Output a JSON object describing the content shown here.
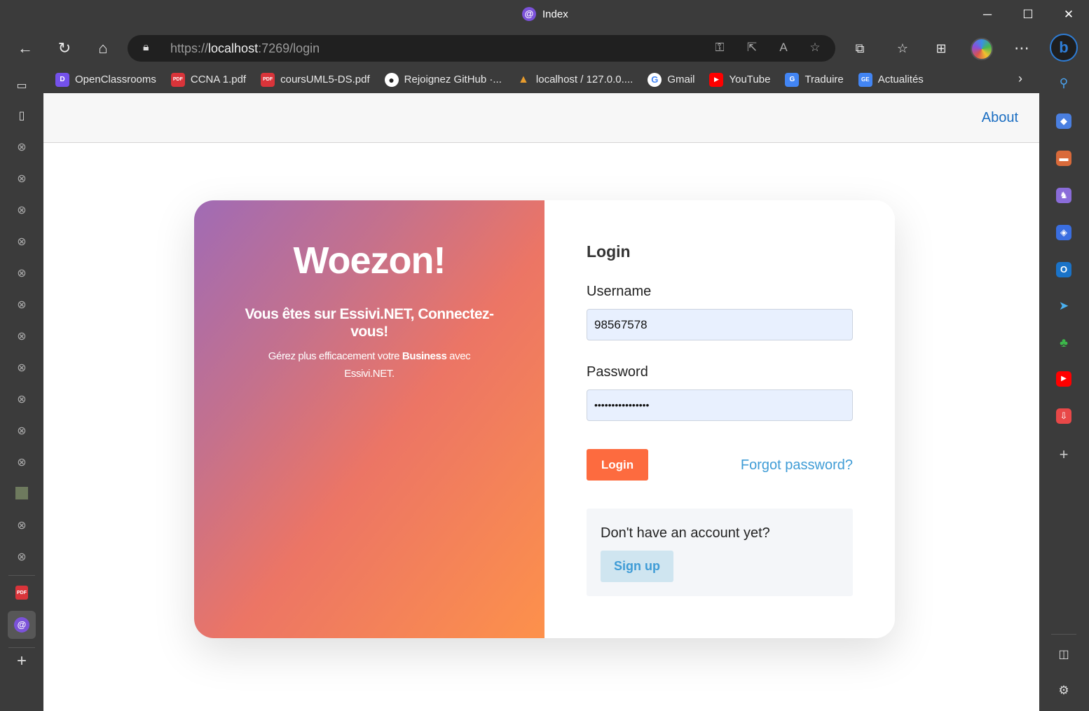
{
  "window": {
    "title": "Index",
    "controls": {
      "minimize": "─",
      "maximize": "☐",
      "close": "✕"
    }
  },
  "nav": {
    "url_scheme": "https://",
    "url_host": "localhost",
    "url_rest": ":7269/login"
  },
  "bookmarks": [
    {
      "label": "OpenClassrooms",
      "icon": "openclassrooms-icon",
      "color": "#7451eb",
      "glyph": "D"
    },
    {
      "label": "CCNA 1.pdf",
      "icon": "pdf-icon",
      "color": "#d9343a",
      "glyph": "PDF"
    },
    {
      "label": "coursUML5-DS.pdf",
      "icon": "pdf-icon",
      "color": "#d9343a",
      "glyph": "PDF"
    },
    {
      "label": "Rejoignez GitHub ·...",
      "icon": "github-icon",
      "color": "#ffffff",
      "glyph": "●"
    },
    {
      "label": "localhost / 127.0.0....",
      "icon": "phpmyadmin-icon",
      "color": "#e89c2d",
      "glyph": "▲"
    },
    {
      "label": "Gmail",
      "icon": "google-icon",
      "color": "#ffffff",
      "glyph": "G"
    },
    {
      "label": "YouTube",
      "icon": "youtube-icon",
      "color": "#ff0000",
      "glyph": "▶"
    },
    {
      "label": "Traduire",
      "icon": "translate-icon",
      "color": "#4285f4",
      "glyph": "G"
    },
    {
      "label": "Actualités",
      "icon": "news-icon",
      "color": "#4285f4",
      "glyph": "GE"
    }
  ],
  "app": {
    "about_link": "About",
    "brand": "Woezon!",
    "tagline": "Vous êtes sur Essivi.NET, Connectez-vous!",
    "sub_before": "Gérez plus efficacement votre ",
    "sub_bold": "Business",
    "sub_after": " avec Essivi.NET.",
    "form": {
      "title": "Login",
      "username_label": "Username",
      "username_value": "98567578",
      "password_label": "Password",
      "password_value": "••••••••••••••••",
      "login_button": "Login",
      "forgot_link": "Forgot password?",
      "signup_question": "Don't have an account yet?",
      "signup_button": "Sign up"
    }
  },
  "colors": {
    "accent_orange": "#fd6b3f",
    "link_blue": "#3f9cd6",
    "about_blue": "#1b6ec2",
    "input_bg": "#e8f0fe"
  }
}
